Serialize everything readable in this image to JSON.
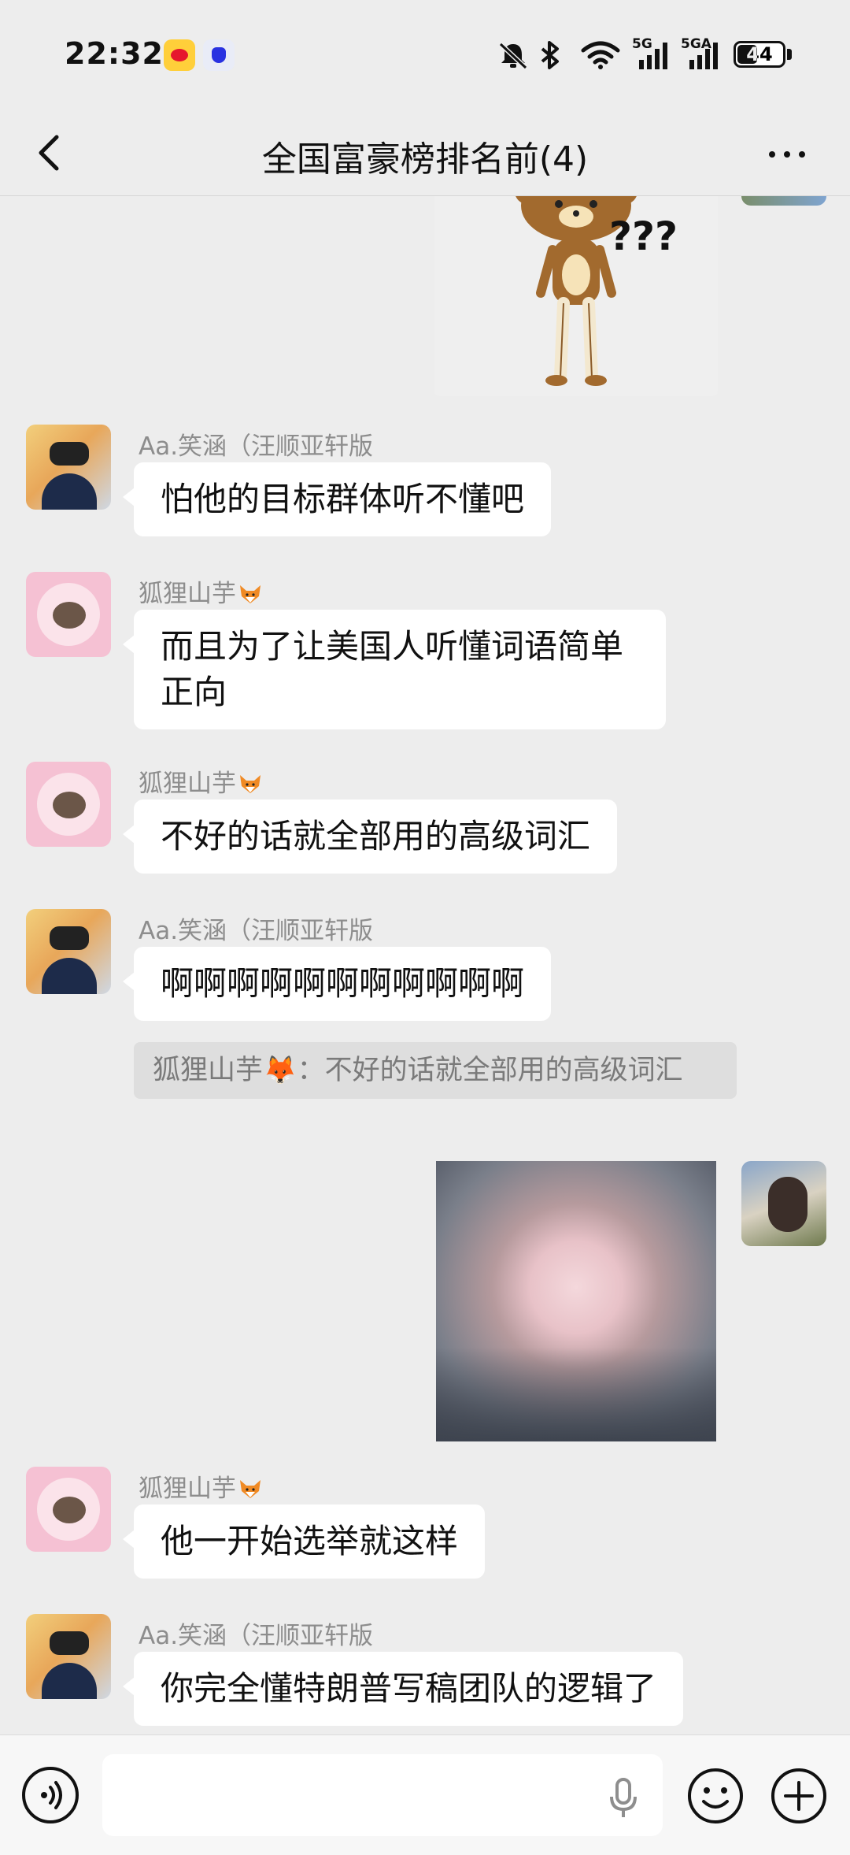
{
  "status_bar": {
    "time": "22:32",
    "battery": "44",
    "battery_level": 0.44,
    "net1": "5G",
    "net2": "5GA",
    "icons": [
      "weibo-icon",
      "baidu-icon",
      "mute-icon",
      "bluetooth-icon",
      "wifi-icon",
      "signal-icon",
      "signal-icon",
      "battery-icon"
    ]
  },
  "header": {
    "title": "全国富豪榜排名前(4)",
    "back_icon": "chevron-left-icon",
    "more_icon": "more-dots-icon"
  },
  "stickers": {
    "top_sticker_text": "???"
  },
  "messages": [
    {
      "sender": "Aa.笑涵（汪顺亚轩版",
      "text": "怕他的目标群体听不懂吧"
    },
    {
      "sender": "狐狸山芋",
      "text": "而且为了让美国人听懂词语简单正向"
    },
    {
      "sender": "狐狸山芋",
      "text": "不好的话就全部用的高级词汇"
    },
    {
      "sender": "Aa.笑涵（汪顺亚轩版",
      "text": "啊啊啊啊啊啊啊啊啊啊啊",
      "quote": "狐狸山芋🦊：不好的话就全部用的高级词汇"
    },
    {
      "sender": "狐狸山芋",
      "text": "他一开始选举就这样"
    },
    {
      "sender": "Aa.笑涵（汪顺亚轩版",
      "text": "你完全懂特朗普写稿团队的逻辑了"
    }
  ],
  "input_bar": {
    "placeholder": "",
    "icons": [
      "voice-icon",
      "microphone-icon",
      "emoji-icon",
      "plus-icon"
    ]
  },
  "colors": {
    "background": "#ededed",
    "bubble": "#ffffff",
    "quote": "#dedede",
    "sender": "#8d8d8d"
  }
}
